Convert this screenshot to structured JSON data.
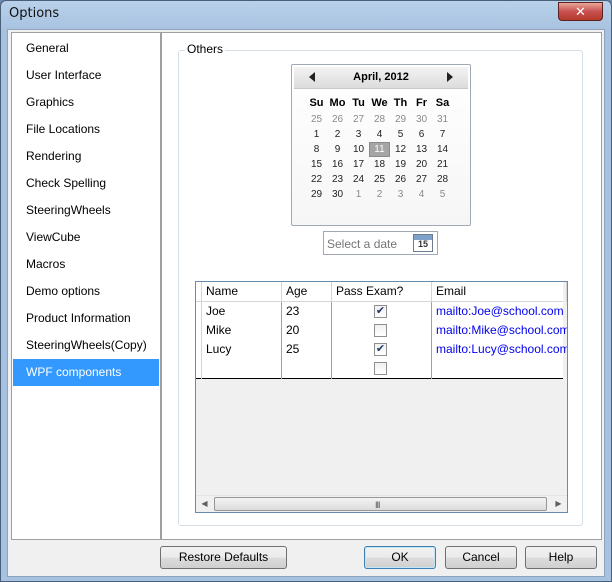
{
  "window": {
    "title": "Options",
    "close_glyph": "✕"
  },
  "sidebar": {
    "items": [
      {
        "label": "General"
      },
      {
        "label": "User Interface"
      },
      {
        "label": "Graphics"
      },
      {
        "label": "File Locations"
      },
      {
        "label": "Rendering"
      },
      {
        "label": "Check Spelling"
      },
      {
        "label": "SteeringWheels"
      },
      {
        "label": "ViewCube"
      },
      {
        "label": "Macros"
      },
      {
        "label": "Demo options"
      },
      {
        "label": "Product Information"
      },
      {
        "label": "SteeringWheels(Copy)"
      },
      {
        "label": "WPF components",
        "selected": true
      }
    ]
  },
  "group": {
    "title": "Others"
  },
  "calendar": {
    "month_label": "April, 2012",
    "days_of_week": [
      "Su",
      "Mo",
      "Tu",
      "We",
      "Th",
      "Fr",
      "Sa"
    ],
    "weeks": [
      [
        "25",
        "26",
        "27",
        "28",
        "29",
        "30",
        "31"
      ],
      [
        "1",
        "2",
        "3",
        "4",
        "5",
        "6",
        "7"
      ],
      [
        "8",
        "9",
        "10",
        "11",
        "12",
        "13",
        "14"
      ],
      [
        "15",
        "16",
        "17",
        "18",
        "19",
        "20",
        "21"
      ],
      [
        "22",
        "23",
        "24",
        "25",
        "26",
        "27",
        "28"
      ],
      [
        "29",
        "30",
        "1",
        "2",
        "3",
        "4",
        "5"
      ]
    ],
    "today": "11"
  },
  "datepicker": {
    "placeholder": "Select a date",
    "icon_day": "15"
  },
  "grid": {
    "columns": [
      "Name",
      "Age",
      "Pass Exam?",
      "Email"
    ],
    "rows": [
      {
        "name": "Joe",
        "age": "23",
        "pass": true,
        "email": "mailto:Joe@school.com"
      },
      {
        "name": "Mike",
        "age": "20",
        "pass": false,
        "email": "mailto:Mike@school.com"
      },
      {
        "name": "Lucy",
        "age": "25",
        "pass": true,
        "email": "mailto:Lucy@school.com"
      }
    ],
    "scroll_grip": "III"
  },
  "buttons": {
    "restore": "Restore Defaults",
    "ok": "OK",
    "cancel": "Cancel",
    "help": "Help"
  }
}
